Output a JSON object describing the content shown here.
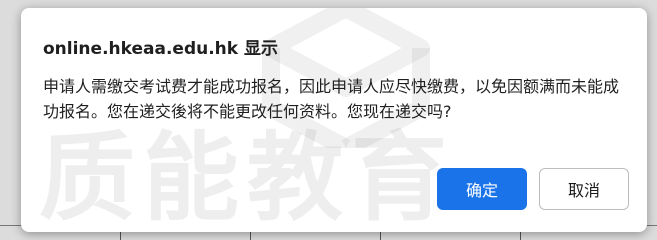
{
  "dialog": {
    "title": "online.hkeaa.edu.hk 显示",
    "message": "申请人需缴交考试费才能成功报名，因此申请人应尽快缴费，以免因额满而未能成功报名。您在递交後将不能更改任何资料。您现在递交吗?",
    "ok_label": "确定",
    "cancel_label": "取消"
  },
  "watermark": {
    "text": "质能教育"
  },
  "colors": {
    "primary_button": "#1a73e8",
    "dialog_background": "#ffffff",
    "text": "#1f1f1f"
  }
}
